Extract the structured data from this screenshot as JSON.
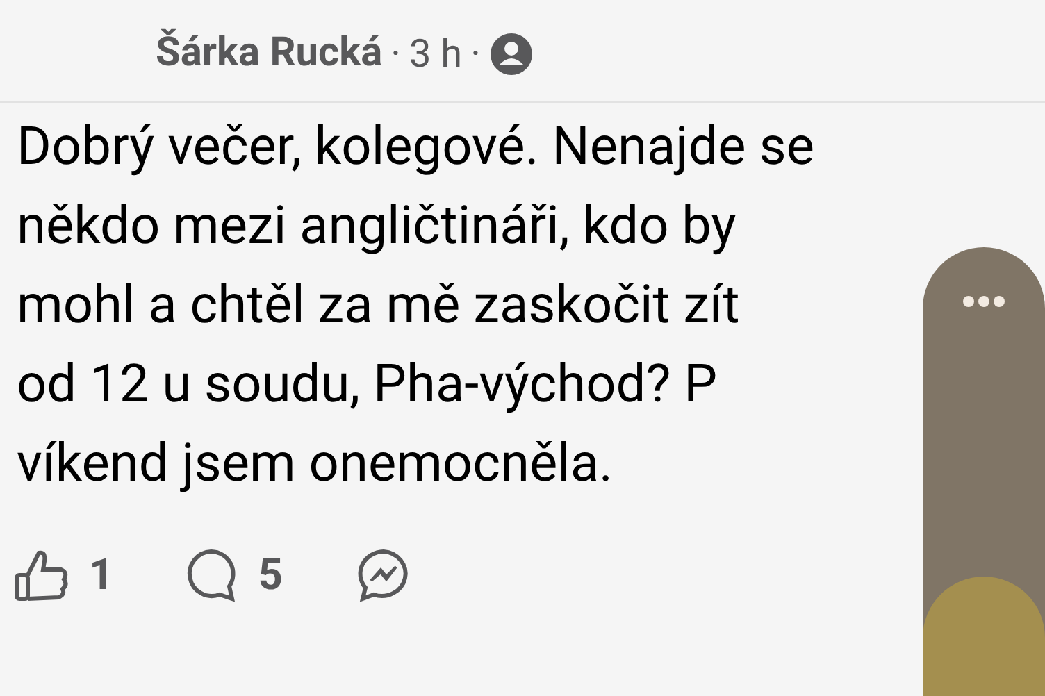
{
  "post": {
    "author": "Šárka Rucká",
    "separator_1": "·",
    "time": "3 h",
    "separator_2": "·",
    "lines": [
      "Dobrý večer, kolegové. Nenajde se",
      "někdo mezi angličtináři, kdo by",
      "mohl a chtěl za mě zaskočit zít",
      "od 12 u soudu, Pha-východ? P",
      "víkend jsem onemocněla."
    ],
    "likes": "1",
    "comments": "5"
  }
}
